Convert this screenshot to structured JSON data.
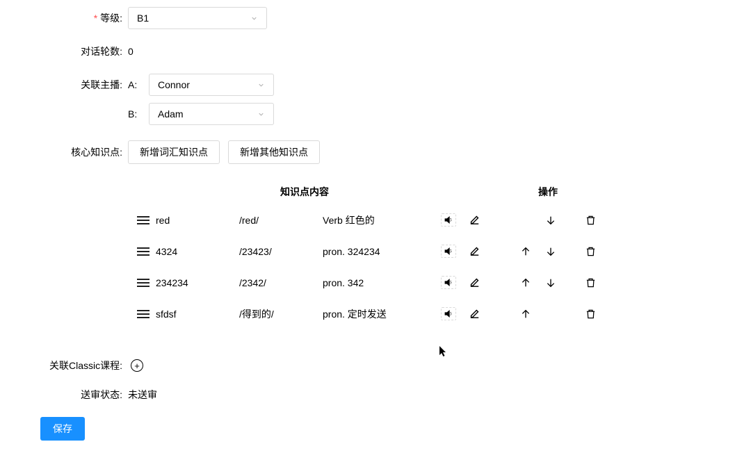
{
  "form": {
    "level": {
      "label": "等级:",
      "value": "B1"
    },
    "turns": {
      "label": "对话轮数:",
      "value": "0"
    },
    "hosts": {
      "label": "关联主播:",
      "a": {
        "sub": "A:",
        "value": "Connor"
      },
      "b": {
        "sub": "B:",
        "value": "Adam"
      }
    },
    "core": {
      "label": "核心知识点:",
      "btn_vocab": "新增词汇知识点",
      "btn_other": "新增其他知识点"
    },
    "classic": {
      "label": "关联Classic课程:"
    },
    "status": {
      "label": "送审状态:",
      "value": "未送审"
    },
    "save_btn": "保存"
  },
  "table": {
    "header_content": "知识点内容",
    "header_action": "操作",
    "rows": [
      {
        "word": "red",
        "phon": "/red/",
        "desc": "Verb 红色的",
        "up": false,
        "down": true
      },
      {
        "word": "4324",
        "phon": "/23423/",
        "desc": "pron. 324234",
        "up": true,
        "down": true
      },
      {
        "word": "234234",
        "phon": "/2342/",
        "desc": "pron. 342",
        "up": true,
        "down": true
      },
      {
        "word": "sfdsf",
        "phon": "/得到的/",
        "desc": "pron. 定时发送",
        "up": true,
        "down": false
      }
    ]
  }
}
